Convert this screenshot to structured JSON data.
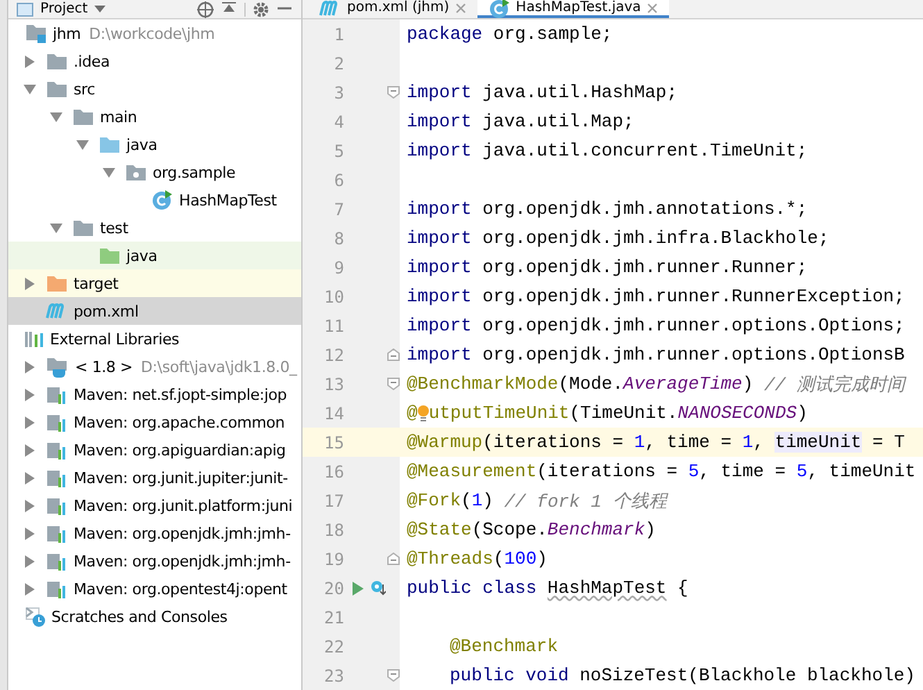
{
  "project_panel": {
    "title": "Project"
  },
  "tree": [
    {
      "label": "jhm",
      "path": "D:\\workcode\\jhm",
      "kind": "module",
      "selected": false,
      "children": [
        {
          "label": ".idea",
          "kind": "folder",
          "expanded": false,
          "selected": false
        },
        {
          "label": "src",
          "kind": "folder",
          "expanded": true,
          "selected": false,
          "children": [
            {
              "label": "main",
              "kind": "folder",
              "expanded": true,
              "selected": false,
              "children": [
                {
                  "label": "java",
                  "kind": "source-folder",
                  "expanded": true,
                  "selected": false,
                  "children": [
                    {
                      "label": "org.sample",
                      "kind": "package",
                      "expanded": true,
                      "selected": false,
                      "children": [
                        {
                          "label": "HashMapTest",
                          "kind": "class",
                          "selected": false
                        }
                      ]
                    }
                  ]
                }
              ]
            },
            {
              "label": "test",
              "kind": "folder",
              "expanded": true,
              "selected": false,
              "children": [
                {
                  "label": "java",
                  "kind": "test-folder",
                  "selected": false
                }
              ]
            }
          ]
        },
        {
          "label": "target",
          "kind": "excluded-folder",
          "expanded": false,
          "selected": false
        },
        {
          "label": "pom.xml",
          "kind": "maven",
          "selected": true
        }
      ]
    },
    {
      "label": "External Libraries",
      "kind": "libraries",
      "selected": false,
      "children": [
        {
          "label": "< 1.8 >",
          "path": "D:\\soft\\java\\jdk1.8.0_",
          "kind": "jdk",
          "expanded": false,
          "selected": false
        },
        {
          "label": "Maven: net.sf.jopt-simple:jop",
          "kind": "library",
          "expanded": false,
          "selected": false
        },
        {
          "label": "Maven: org.apache.common",
          "kind": "library",
          "expanded": false,
          "selected": false
        },
        {
          "label": "Maven: org.apiguardian:apig",
          "kind": "library",
          "expanded": false,
          "selected": false
        },
        {
          "label": "Maven: org.junit.jupiter:junit-",
          "kind": "library",
          "expanded": false,
          "selected": false
        },
        {
          "label": "Maven: org.junit.platform:juni",
          "kind": "library",
          "expanded": false,
          "selected": false
        },
        {
          "label": "Maven: org.openjdk.jmh:jmh-",
          "kind": "library",
          "expanded": false,
          "selected": false
        },
        {
          "label": "Maven: org.openjdk.jmh:jmh-",
          "kind": "library",
          "expanded": false,
          "selected": false
        },
        {
          "label": "Maven: org.opentest4j:opent",
          "kind": "library",
          "expanded": false,
          "selected": false
        }
      ]
    },
    {
      "label": "Scratches and Consoles",
      "kind": "scratches",
      "selected": false
    }
  ],
  "editor": {
    "tabs": [
      {
        "label": "pom.xml (jhm)",
        "kind": "maven",
        "selected": false
      },
      {
        "label": "HashMapTest.java",
        "kind": "class",
        "selected": true
      }
    ],
    "lines": [
      {
        "number": "1",
        "current": false,
        "tokens": [
          {
            "kind": "kw",
            "text": "package"
          },
          {
            "kind": "plain",
            "text": " org.sample;"
          }
        ]
      },
      {
        "number": "2",
        "current": false
      },
      {
        "number": "3",
        "current": false,
        "fold_start": true,
        "tokens": [
          {
            "kind": "kw",
            "text": "import"
          },
          {
            "kind": "plain",
            "text": " java.util.HashMap;"
          }
        ]
      },
      {
        "number": "4",
        "current": false,
        "tokens": [
          {
            "kind": "kw",
            "text": "import"
          },
          {
            "kind": "plain",
            "text": " java.util.Map;"
          }
        ]
      },
      {
        "number": "5",
        "current": false,
        "tokens": [
          {
            "kind": "kw",
            "text": "import"
          },
          {
            "kind": "plain",
            "text": " java.util.concurrent.TimeUnit;"
          }
        ]
      },
      {
        "number": "6",
        "current": false
      },
      {
        "number": "7",
        "current": false,
        "tokens": [
          {
            "kind": "kw",
            "text": "import"
          },
          {
            "kind": "plain",
            "text": " org.openjdk.jmh.annotations.*;"
          }
        ]
      },
      {
        "number": "8",
        "current": false,
        "tokens": [
          {
            "kind": "kw",
            "text": "import"
          },
          {
            "kind": "plain",
            "text": " org.openjdk.jmh.infra.Blackhole;"
          }
        ]
      },
      {
        "number": "9",
        "current": false,
        "tokens": [
          {
            "kind": "kw",
            "text": "import"
          },
          {
            "kind": "plain",
            "text": " org.openjdk.jmh.runner.Runner;"
          }
        ]
      },
      {
        "number": "10",
        "current": false,
        "tokens": [
          {
            "kind": "kw",
            "text": "import"
          },
          {
            "kind": "plain",
            "text": " org.openjdk.jmh.runner.RunnerException;"
          }
        ]
      },
      {
        "number": "11",
        "current": false,
        "tokens": [
          {
            "kind": "kw",
            "text": "import"
          },
          {
            "kind": "plain",
            "text": " org.openjdk.jmh.runner.options.Options;"
          }
        ]
      },
      {
        "number": "12",
        "current": false,
        "fold_end": true,
        "tokens": [
          {
            "kind": "kw",
            "text": "import"
          },
          {
            "kind": "plain",
            "text": " org.openjdk.jmh.runner.options.OptionsB"
          }
        ]
      },
      {
        "number": "13",
        "current": false,
        "fold_start": true,
        "tokens": [
          {
            "kind": "anno",
            "text": "@BenchmarkMode"
          },
          {
            "kind": "plain",
            "text": "(Mode."
          },
          {
            "kind": "const",
            "text": "AverageTime"
          },
          {
            "kind": "plain",
            "text": ") "
          },
          {
            "kind": "comment",
            "text": "// 测试完成时间"
          }
        ]
      },
      {
        "number": "14",
        "current": false,
        "tokens": [
          {
            "kind": "anno",
            "text": "@"
          },
          {
            "kind": "bulb"
          },
          {
            "kind": "anno",
            "text": "utputTimeUnit"
          },
          {
            "kind": "plain",
            "text": "(TimeUnit."
          },
          {
            "kind": "const",
            "text": "NANOSECONDS"
          },
          {
            "kind": "plain",
            "text": ")"
          }
        ]
      },
      {
        "number": "15",
        "current": true,
        "tokens": [
          {
            "kind": "anno",
            "text": "@Warmup"
          },
          {
            "kind": "plain",
            "text": "(iterations = "
          },
          {
            "kind": "num",
            "text": "1"
          },
          {
            "kind": "plain",
            "text": ", time = "
          },
          {
            "kind": "num",
            "text": "1"
          },
          {
            "kind": "plain",
            "text": ", "
          },
          {
            "kind": "sel",
            "text": "timeUnit"
          },
          {
            "kind": "plain",
            "text": " = T"
          }
        ]
      },
      {
        "number": "16",
        "current": false,
        "tokens": [
          {
            "kind": "anno",
            "text": "@Measurement"
          },
          {
            "kind": "plain",
            "text": "(iterations = "
          },
          {
            "kind": "num",
            "text": "5"
          },
          {
            "kind": "plain",
            "text": ", time = "
          },
          {
            "kind": "num",
            "text": "5"
          },
          {
            "kind": "plain",
            "text": ", timeUnit"
          }
        ]
      },
      {
        "number": "17",
        "current": false,
        "tokens": [
          {
            "kind": "anno",
            "text": "@Fork"
          },
          {
            "kind": "plain",
            "text": "("
          },
          {
            "kind": "num",
            "text": "1"
          },
          {
            "kind": "plain",
            "text": ") "
          },
          {
            "kind": "comment",
            "text": "// fork 1 个线程"
          }
        ]
      },
      {
        "number": "18",
        "current": false,
        "tokens": [
          {
            "kind": "anno",
            "text": "@State"
          },
          {
            "kind": "plain",
            "text": "(Scope."
          },
          {
            "kind": "const",
            "text": "Benchmark"
          },
          {
            "kind": "plain",
            "text": ")"
          }
        ]
      },
      {
        "number": "19",
        "current": false,
        "fold_end": true,
        "tokens": [
          {
            "kind": "anno",
            "text": "@Threads"
          },
          {
            "kind": "plain",
            "text": "("
          },
          {
            "kind": "num",
            "text": "100"
          },
          {
            "kind": "plain",
            "text": ")"
          }
        ]
      },
      {
        "number": "20",
        "current": false,
        "run": true,
        "tokens": [
          {
            "kind": "kw",
            "text": "public class "
          },
          {
            "kind": "typo",
            "text": "HashMapTest"
          },
          {
            "kind": "plain",
            "text": " {"
          }
        ]
      },
      {
        "number": "21",
        "current": false
      },
      {
        "number": "22",
        "current": false,
        "indented": true,
        "tokens": [
          {
            "kind": "anno",
            "text": "@Benchmark"
          }
        ]
      },
      {
        "number": "23",
        "current": false,
        "fold_start": true,
        "indented": true,
        "tokens": [
          {
            "kind": "kw",
            "text": "public void"
          },
          {
            "kind": "plain",
            "text": " noSizeTest(Blackhole blackhole)"
          }
        ]
      }
    ]
  }
}
